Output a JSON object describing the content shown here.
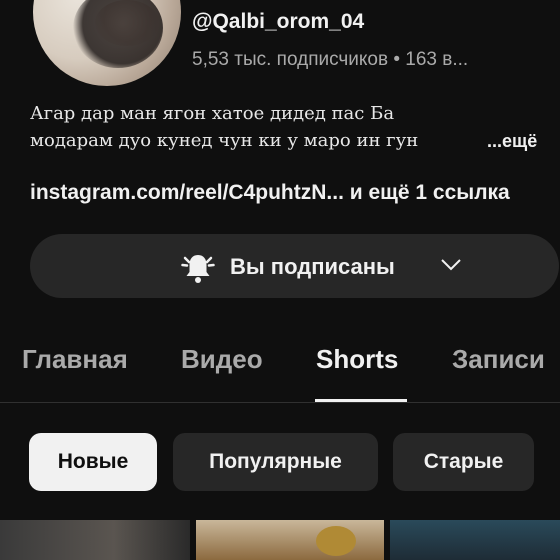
{
  "channel": {
    "handle": "@Qalbi_orom_04",
    "meta": "5,53 тыс. подписчиков • 163 в...",
    "description_line1": "Агар дар ман ягон хатое дидед пас Ба",
    "description_line2": "модарам дуо кунед чун ки у маро ин гун",
    "more_label": "...ещё",
    "links": "instagram.com/reel/C4puhtzN... и ещё 1 ссылка"
  },
  "subscribe": {
    "label": "Вы подписаны",
    "icon": "bell-ringing-icon"
  },
  "tabs": [
    {
      "label": "Главная"
    },
    {
      "label": "Видео"
    },
    {
      "label": "Shorts"
    },
    {
      "label": "Записи"
    }
  ],
  "active_tab": "Shorts",
  "filters": [
    {
      "label": "Новые",
      "selected": true
    },
    {
      "label": "Популярные",
      "selected": false
    },
    {
      "label": "Старые",
      "selected": false
    }
  ],
  "colors": {
    "background": "#0f0f0f",
    "chip_background": "#272727",
    "chip_selected_background": "#f1f1f1",
    "secondary_text": "#aaaaaa"
  }
}
